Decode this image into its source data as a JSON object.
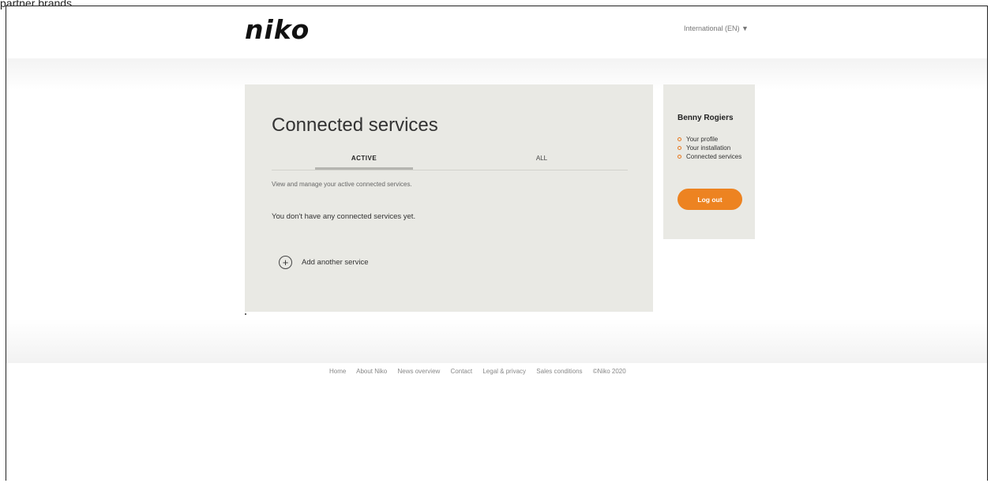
{
  "top_fragment": "partner brands.",
  "header": {
    "logo": "niko",
    "language": "International (EN) ▼"
  },
  "main": {
    "title": "Connected services",
    "tabs": [
      {
        "label": "ACTIVE",
        "active": true
      },
      {
        "label": "ALL",
        "active": false
      }
    ],
    "intro": "View and manage your active connected services.",
    "empty_message": "You don't have any connected services yet.",
    "add_service_label": "Add another service"
  },
  "sidebar": {
    "user_name": "Benny Rogiers",
    "items": [
      {
        "label": "Your profile"
      },
      {
        "label": "Your installation"
      },
      {
        "label": "Connected services"
      }
    ],
    "logout_label": "Log out"
  },
  "footer": {
    "links": [
      "Home",
      "About Niko",
      "News overview",
      "Contact",
      "Legal & privacy",
      "Sales conditions"
    ],
    "copyright": "©Niko 2020"
  },
  "colors": {
    "accent": "#ed8321",
    "panel": "#e9e9e4"
  }
}
